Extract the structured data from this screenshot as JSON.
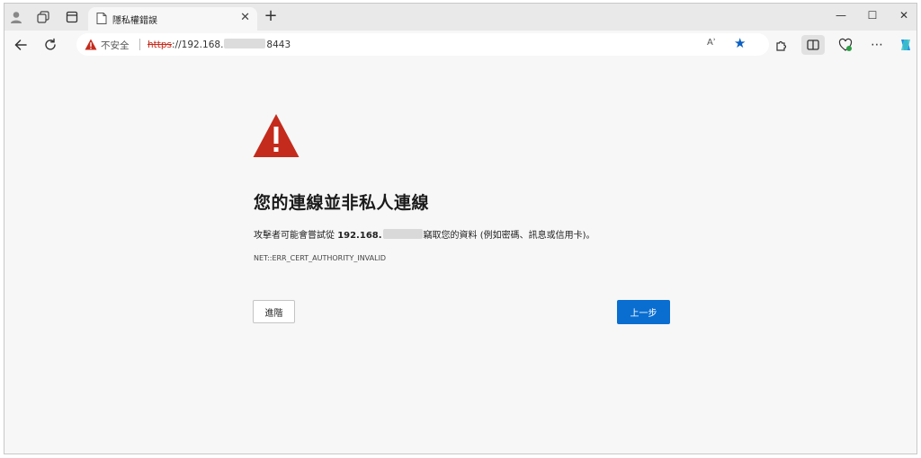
{
  "tab": {
    "title": "隱私權錯誤",
    "close_glyph": "✕"
  },
  "new_tab_glyph": "+",
  "window_controls": {
    "minimize": "—",
    "maximize": "☐",
    "close": "✕"
  },
  "toolbar": {
    "back_icon": "back-arrow-icon",
    "refresh_icon": "refresh-icon"
  },
  "address_bar": {
    "security_label": "不安全",
    "url_scheme": "https",
    "url_host_visible": "://192.168.",
    "url_port_visible": "8443"
  },
  "read_aloud_label": "Aʾ",
  "page": {
    "heading": "您的連線並非私人連線",
    "message_prefix": "攻擊者可能會嘗試從 ",
    "message_host": "192.168.",
    "message_suffix": "竊取您的資料 (例如密碼、訊息或信用卡)。",
    "error_code": "NET::ERR_CERT_AUTHORITY_INVALID",
    "advanced_button": "進階",
    "back_button": "上一步"
  },
  "colors": {
    "warning_red": "#c42b1c",
    "primary_blue": "#0a6ed1"
  }
}
